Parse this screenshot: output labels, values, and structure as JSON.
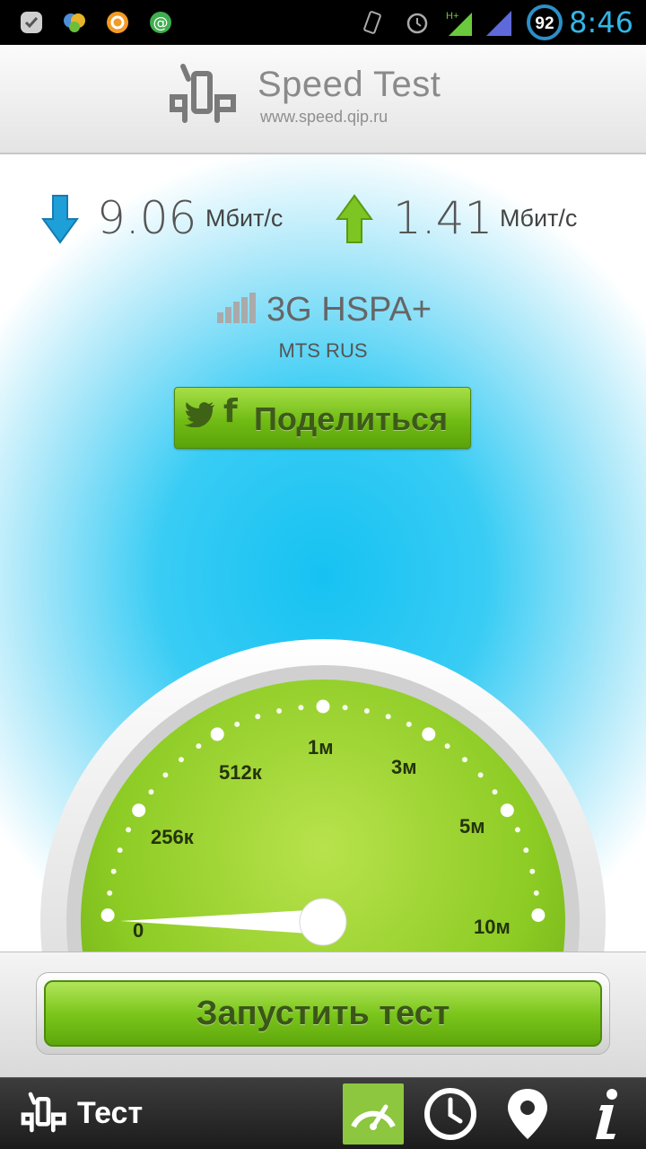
{
  "status_bar": {
    "time": "8:46",
    "battery_level": "92",
    "network_indicator": "H+",
    "icons": [
      "check-app-icon",
      "chat-app-icon",
      "mail-app-icon",
      "email-at-icon",
      "vibrate-icon",
      "alarm-icon",
      "data-activity-icon",
      "signal-icon",
      "battery-icon"
    ]
  },
  "header": {
    "title": "Speed Test",
    "url": "www.speed.qip.ru"
  },
  "results": {
    "download_value": "9.06",
    "download_unit": "Мбит/с",
    "upload_value": "1.41",
    "upload_unit": "Мбит/с"
  },
  "network": {
    "type": "3G HSPA+",
    "operator": "MTS RUS"
  },
  "share_button": {
    "label": "Поделиться",
    "facebook_glyph": "f"
  },
  "gauge": {
    "scale_labels": [
      "0",
      "256к",
      "512к",
      "1м",
      "3м",
      "5м",
      "10м"
    ],
    "needle_value_label": "0"
  },
  "run_button": {
    "label": "Запустить тест"
  },
  "bottom_nav": {
    "label": "Тест",
    "items": [
      "speedometer-icon",
      "history-clock-icon",
      "map-pin-icon",
      "info-icon"
    ]
  },
  "colors": {
    "accent_green": "#8dc63f",
    "status_blue": "#33b5e5",
    "download_arrow": "#1e9fd8",
    "upload_arrow": "#7cc522"
  }
}
